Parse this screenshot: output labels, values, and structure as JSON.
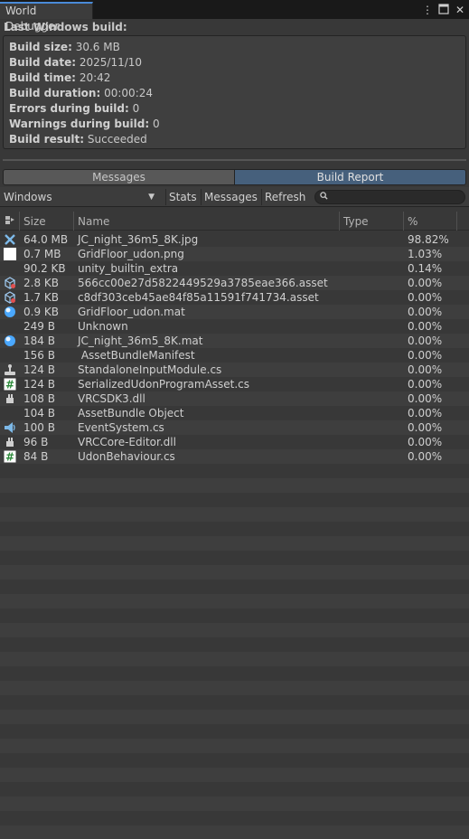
{
  "window": {
    "tab_title": "World Debugger"
  },
  "summary": {
    "heading": "Last Windows build:",
    "rows": [
      {
        "label": "Build size:",
        "value": "30.6 MB"
      },
      {
        "label": "Build date:",
        "value": "2025/11/10"
      },
      {
        "label": "Build time:",
        "value": "20:42"
      },
      {
        "label": "Build duration:",
        "value": "00:00:24"
      },
      {
        "label": "Errors during build:",
        "value": "0"
      },
      {
        "label": "Warnings during build:",
        "value": "0"
      },
      {
        "label": "Build result:",
        "value": "Succeeded"
      }
    ]
  },
  "view_toggle": {
    "messages_label": "Messages",
    "build_report_label": "Build Report",
    "active": "Build Report"
  },
  "toolbar": {
    "platform_value": "Windows",
    "stats_label": "Stats",
    "messages_label": "Messages",
    "refresh_label": "Refresh",
    "search_value": ""
  },
  "table": {
    "columns": [
      "Size",
      "Name",
      "Type",
      "%"
    ],
    "rows": [
      {
        "icon": "texture-icon",
        "size": "64.0 MB",
        "name": "JC_night_36m5_8K.jpg",
        "type": "",
        "pct": "98.82%"
      },
      {
        "icon": "image-icon",
        "size": "0.7 MB",
        "name": "GridFloor_udon.png",
        "type": "",
        "pct": "1.03%"
      },
      {
        "icon": "",
        "size": "90.2 KB",
        "name": "unity_builtin_extra",
        "type": "",
        "pct": "0.14%"
      },
      {
        "icon": "asset-cube-icon",
        "size": "2.8 KB",
        "name": "566cc00e27d5822449529a3785eae366.asset",
        "type": "",
        "pct": "0.00%"
      },
      {
        "icon": "asset-cube-icon",
        "size": "1.7 KB",
        "name": "c8df303ceb45ae84f85a11591f741734.asset",
        "type": "",
        "pct": "0.00%"
      },
      {
        "icon": "material-icon",
        "size": "0.9 KB",
        "name": "GridFloor_udon.mat",
        "type": "",
        "pct": "0.00%"
      },
      {
        "icon": "",
        "size": "249 B",
        "name": "Unknown",
        "type": "",
        "pct": "0.00%"
      },
      {
        "icon": "material-icon",
        "size": "184 B",
        "name": "JC_night_36m5_8K.mat",
        "type": "",
        "pct": "0.00%"
      },
      {
        "icon": "",
        "size": "156 B",
        "name": " AssetBundleManifest",
        "type": "",
        "pct": "0.00%"
      },
      {
        "icon": "input-module-icon",
        "size": "124 B",
        "name": "StandaloneInputModule.cs",
        "type": "",
        "pct": "0.00%"
      },
      {
        "icon": "csharp-script-icon",
        "size": "124 B",
        "name": "SerializedUdonProgramAsset.cs",
        "type": "",
        "pct": "0.00%"
      },
      {
        "icon": "dll-plugin-icon",
        "size": "108 B",
        "name": "VRCSDK3.dll",
        "type": "",
        "pct": "0.00%"
      },
      {
        "icon": "",
        "size": "104 B",
        "name": "AssetBundle Object",
        "type": "",
        "pct": "0.00%"
      },
      {
        "icon": "event-system-icon",
        "size": "100 B",
        "name": "EventSystem.cs",
        "type": "",
        "pct": "0.00%"
      },
      {
        "icon": "dll-plugin-icon",
        "size": "96 B",
        "name": "VRCCore-Editor.dll",
        "type": "",
        "pct": "0.00%"
      },
      {
        "icon": "csharp-script-icon",
        "size": "84 B",
        "name": "UdonBehaviour.cs",
        "type": "",
        "pct": "0.00%"
      }
    ]
  }
}
